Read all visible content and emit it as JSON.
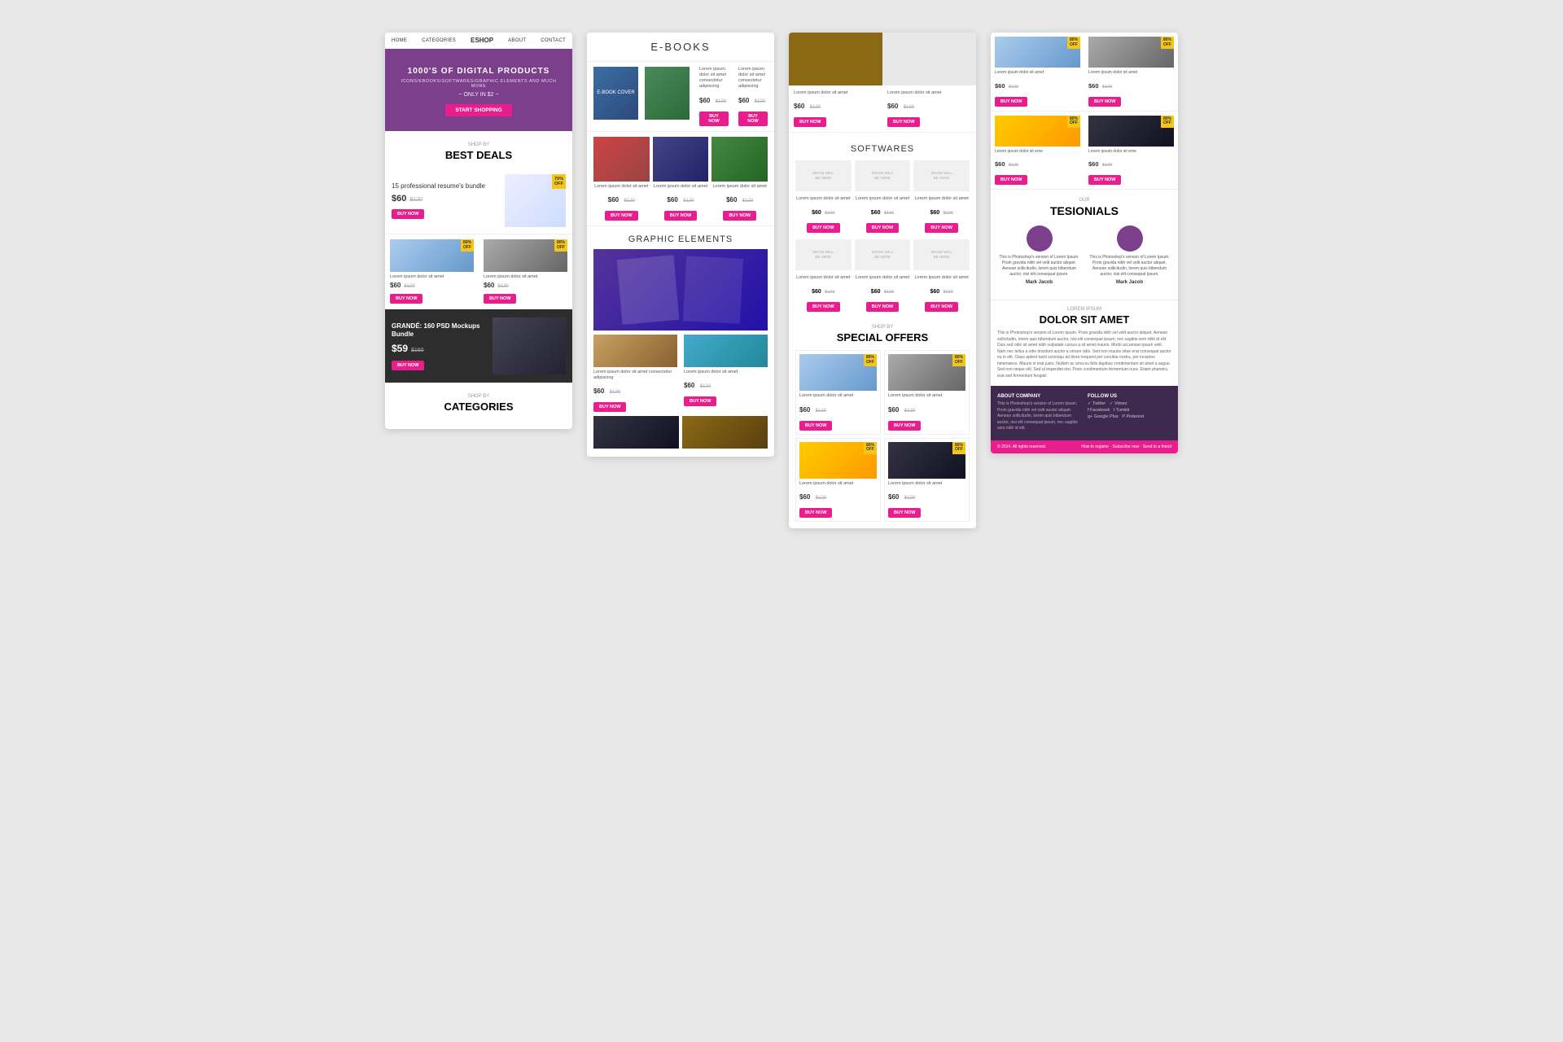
{
  "nav": {
    "items": [
      "HOME",
      "CATEGORIES",
      "ESHOP",
      "ABOUT",
      "CONTACT"
    ]
  },
  "hero": {
    "title": "1000'S OF DIGITAL PRODUCTS",
    "sub": "ICONS/EBOOKS/SOFTWARES/GRAPHIC ELEMENTS AND MUCH MORE",
    "price": "~ ONLY IN $2 ~",
    "cta": "START SHOPPING"
  },
  "best_deals": {
    "label": "SHOP BY",
    "title": "BEST DEALS",
    "featured": {
      "title": "15 professional resume's bundle",
      "price": "$60",
      "old_price": "$120",
      "badge": "70% OFF",
      "cta": "BUY NOW"
    }
  },
  "products_row1": [
    {
      "desc": "Lorem ipsum dolor sit amet",
      "price": "$60",
      "old_price": "$120",
      "badge": "80% OFF",
      "cta": "BUY NOW"
    },
    {
      "desc": "Lorem ipsum dolor sit amet",
      "price": "$60",
      "old_price": "$120",
      "badge": "80% OFF",
      "cta": "BUY NOW"
    }
  ],
  "grande": {
    "title": "GRANDÉ: 160 PSD Mockups Bundle",
    "price": "$59",
    "old_price": "$160",
    "cta": "BUY NOW"
  },
  "categories": {
    "label": "SHOP BY",
    "title": "CATEGORIES"
  },
  "ebooks": {
    "title": "E-BOOKS",
    "items": [
      {
        "desc": "Lorem ipsum dolor sit amet consectetur adipiscing",
        "price": "$60",
        "old_price": "$120",
        "cta": "BUY NOW"
      },
      {
        "desc": "Lorem ipsum dolor sit amet consectetur adipiscing",
        "price": "$60",
        "old_price": "$120",
        "cta": "BUY NOW"
      }
    ],
    "three_items": [
      {
        "desc": "Lorem ipsum dolor sit amet",
        "price": "$60",
        "old_price": "$120",
        "cta": "BUY NOW"
      },
      {
        "desc": "Lorem ipsum dolor sit amet",
        "price": "$60",
        "old_price": "$120",
        "cta": "BUY NOW"
      },
      {
        "desc": "Lorem ipsum dolor sit amet",
        "price": "$60",
        "old_price": "$120",
        "cta": "BUY NOW"
      }
    ]
  },
  "graphic_elements": {
    "title": "GRAPHIC ELEMENTS",
    "items": [
      {
        "desc": "Lorem ipsum dolor sit amet consectetur adipiscing",
        "price": "$60",
        "old_price": "$120",
        "cta": "BUY NOW"
      },
      {
        "desc": "Lorem ipsum dolor sit amet",
        "price": "$60",
        "old_price": "$120",
        "cta": "BUY NOW"
      }
    ]
  },
  "softwares": {
    "title": "SOFTWARES",
    "placeholder": "IMAGE WILL BE HERE",
    "items_top": [
      {
        "desc": "Lorem ipsum dolor sit amet",
        "price": "$60",
        "old_price": "$120",
        "cta": "BUY NOW"
      },
      {
        "desc": "Lorem ipsum dolor sit amet",
        "price": "$60",
        "old_price": "$120",
        "cta": "BUY NOW"
      },
      {
        "desc": "Lorem ipsum dolor sit amet",
        "price": "$60",
        "old_price": "$120",
        "cta": "BUY NOW"
      }
    ],
    "items_bottom": [
      {
        "desc": "Lorem ipsum dolor sit amet",
        "price": "$60",
        "old_price": "$120",
        "cta": "BUY NOW"
      },
      {
        "desc": "Lorem ipsum dolor sit amet",
        "price": "$60",
        "old_price": "$120",
        "cta": "BUY NOW"
      },
      {
        "desc": "Lorem ipsum dolor sit amet",
        "price": "$60",
        "old_price": "$120",
        "cta": "BUY NOW"
      }
    ]
  },
  "special_offers": {
    "label": "SHOP BY",
    "title": "SPECIAL OFFERS",
    "items": [
      {
        "desc": "Lorem ipsum dolor sit amet",
        "price": "$60",
        "old_price": "$120",
        "badge": "80% OFF",
        "cta": "BUY NOW"
      },
      {
        "desc": "Lorem ipsum dolor sit amet",
        "price": "$60",
        "old_price": "$120",
        "badge": "80% OFF",
        "cta": "BUY NOW"
      },
      {
        "desc": "Lorem ipsum dolor sit amet",
        "price": "$60",
        "old_price": "$120",
        "badge": "80% OFF",
        "cta": "BUY NOW"
      },
      {
        "desc": "Lorem ipsum dolor sit amet",
        "price": "$60",
        "old_price": "$120",
        "badge": "80% OFF",
        "cta": "BUY NOW"
      }
    ]
  },
  "products_4col_top": [
    {
      "desc": "Lorem ipsum dolor sit amet",
      "price": "$60",
      "old_price": "$120",
      "badge": "80% OFF",
      "cta": "BUY NOW"
    },
    {
      "desc": "Lorem ipsum dolor sit amet",
      "price": "$60",
      "old_price": "$120",
      "badge": "80% OFF",
      "cta": "BUY NOW"
    },
    {
      "desc": "Lorem ipsum dolor sit eme",
      "price": "$60",
      "old_price": "$120",
      "badge": "80% OFF",
      "cta": "BUY NOW"
    },
    {
      "desc": "Lorem ipsum dolor sit eme",
      "price": "$60",
      "old_price": "$120",
      "badge": "80% OFF",
      "cta": "BUY NOW"
    }
  ],
  "testimonials": {
    "our_label": "OUR",
    "title": "TESIONIALS",
    "items": [
      {
        "text": "This is Photoshop's version of Lorem Ipsum. Proin gravida nibh vel velit auctor aliquet. Aenean sollicitudin, lorem quis bibendum auctor, nisi elit consequat ipsum.",
        "name": "Mark Jacob"
      },
      {
        "text": "This is Photoshop's version of Lorem Ipsum. Proin gravida nibh vel velit auctor aliquet. Aenean sollicitudin, lorem quis bibendum auctor, nisi elit consequat ipsum.",
        "name": "Mark Jacob"
      }
    ]
  },
  "lorem_section": {
    "label": "LOREM IPSUM",
    "title": "DOLOR SIT AMET",
    "text": "This is Photoshop's version of Lorem Ipsum. Proin gravida nibh vel velit auctor aliquet. Aenean sollicitudin, lorem quis bibendum auctor, nisi elit consequat ipsum, nec sagittis sem nibh id elit. Duis sed odio sit amet nibh vulputate cursus a sit amet mauris. Morbi accumsan ipsum velit. Nam nec tellus a odio tincidunt auctor a ornare odio. Sed non mauris vitae erat consequat auctor eu in elit. Class aptent taciti sociosqu ad litora torquent per conubia nostra, per inceptos himenaeos. Mauris in erat justo. Nullam ac urna eu felis dapibus condimentum sit amet a augue.\n\nSed non neque elit. Sed ut imperdiet nisi. Proin condimentum fermentum nunc. Etiam pharetra, erat sed fermentum feugiat:"
  },
  "footer": {
    "about_label": "ABOUT COMPANY",
    "about_text": "This is Photoshop's version of Lorem Ipsum. Proin gravida nibh vel velit auctor aliquet. Aenean sollicitudin, lorem quis bibendum auctor, nisi elit consequat ipsum, nec sagittis sem nibh id elit.",
    "follow_label": "FOLLOW US",
    "links": [
      "Twitter",
      "Vimeo",
      "Facebook",
      "Tumblr",
      "Google Plus",
      "Pinterest"
    ],
    "copyright": "© 2014. All rights reserved.",
    "links_bottom": [
      "How to register",
      "Subscribe now",
      "Send to a friend"
    ]
  },
  "colors": {
    "primary": "#e91e8c",
    "purple": "#7b3f8c",
    "badge_yellow": "#f5c518",
    "footer_dark": "#3d2a4e",
    "text": "#333",
    "light_text": "#999"
  }
}
